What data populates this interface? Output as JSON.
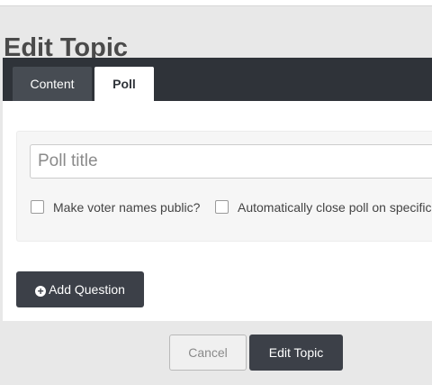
{
  "page": {
    "title": "Edit Topic"
  },
  "tabs": [
    {
      "label": "Content",
      "active": false
    },
    {
      "label": "Poll",
      "active": true
    }
  ],
  "poll": {
    "title_placeholder": "Poll title",
    "title_value": "",
    "options": {
      "public_voters_label": "Make voter names public?",
      "public_voters_checked": false,
      "auto_close_label": "Automatically close poll on specific",
      "auto_close_checked": false
    },
    "add_question_label": "Add Question",
    "add_question_icon": "plus-circle-icon"
  },
  "actions": {
    "cancel_label": "Cancel",
    "submit_label": "Edit Topic"
  },
  "colors": {
    "dark": "#2f3339",
    "button_dark": "#3c4048",
    "background": "#e8e8e8"
  }
}
